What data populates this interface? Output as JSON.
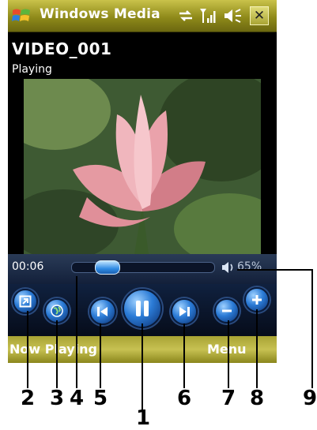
{
  "titlebar": {
    "app_title": "Windows Media",
    "start_icon": "windows-flag-icon",
    "status_icons": [
      "connectivity-icon",
      "signal-strength-icon",
      "speaker-icon"
    ],
    "close_label": "✕"
  },
  "clip": {
    "title": "VIDEO_001",
    "status": "Playing"
  },
  "playback": {
    "elapsed": "00:06",
    "seek_progress": 0.25,
    "volume_text": "65%"
  },
  "controls": {
    "icons": [
      "fullscreen-icon",
      "web-icon",
      "previous-icon",
      "pause-icon",
      "next-icon",
      "volume-down-icon",
      "volume-up-icon"
    ]
  },
  "softkeys": {
    "left": "Now Playing",
    "right": "Menu"
  },
  "callouts": {
    "n1": "1",
    "n2": "2",
    "n3": "3",
    "n4": "4",
    "n5": "5",
    "n6": "6",
    "n7": "7",
    "n8": "8",
    "n9": "9"
  },
  "colors": {
    "titlebar": "#8f8a1a",
    "control_accent": "#2b7bd6",
    "softkey_bar": "#c7c152"
  }
}
